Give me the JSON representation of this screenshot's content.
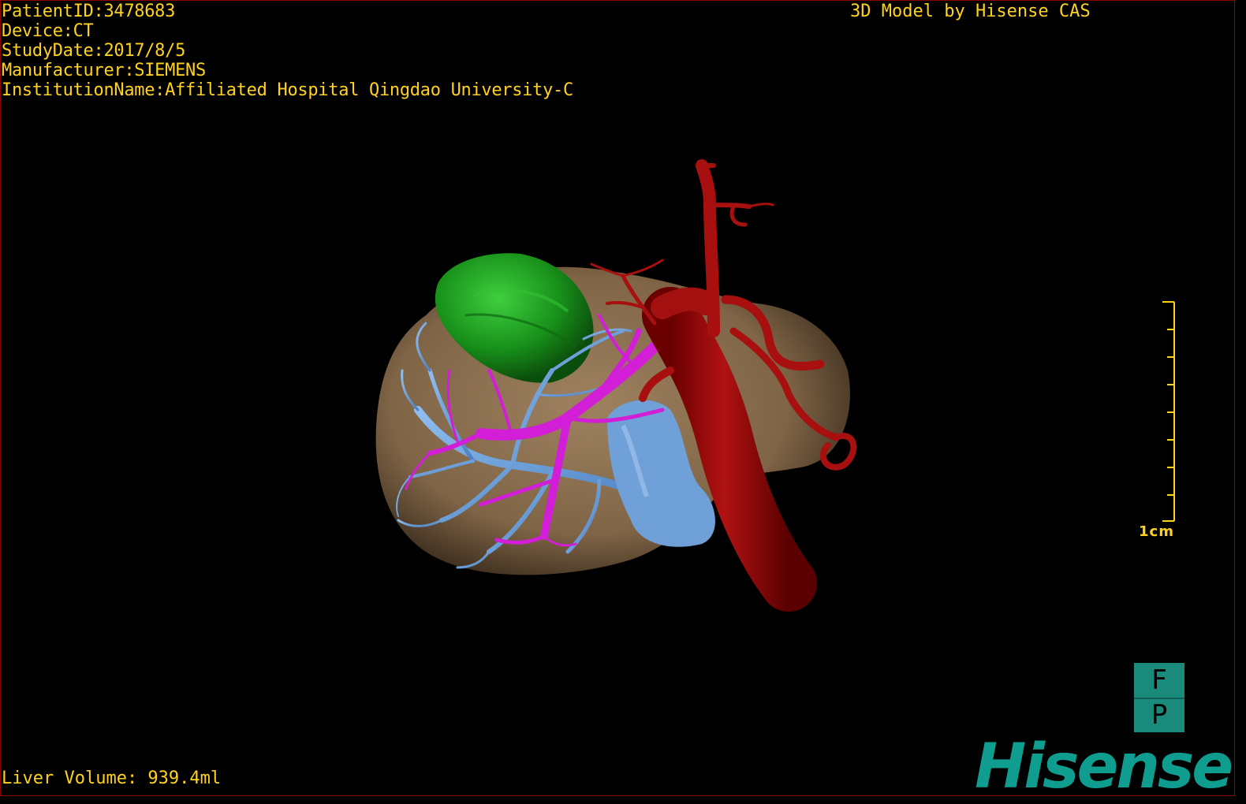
{
  "header": {
    "patient_id": "PatientID:3478683",
    "device": "Device:CT",
    "study_date": "StudyDate:2017/8/5",
    "manufacturer": "Manufacturer:SIEMENS",
    "institution": "InstitutionName:Affiliated Hospital Qingdao University-C"
  },
  "brand_caption": "3D Model by Hisense CAS",
  "footer": {
    "liver_volume": "Liver Volume: 939.4ml"
  },
  "scale": {
    "label": "1cm"
  },
  "orientation": {
    "top": "F",
    "bottom": "P"
  },
  "logo": "Hisense",
  "colors": {
    "text": "#ffd21e",
    "liver": "#8b6f4e",
    "tumor": "#1f9e1f",
    "hepatic_vein": "#6fa6e0",
    "portal_vein": "#d21ed6",
    "artery": "#9b0a0a",
    "logo": "#0f9d8f"
  },
  "icons": [
    "orientation-cube-icon",
    "scale-bar-icon"
  ]
}
